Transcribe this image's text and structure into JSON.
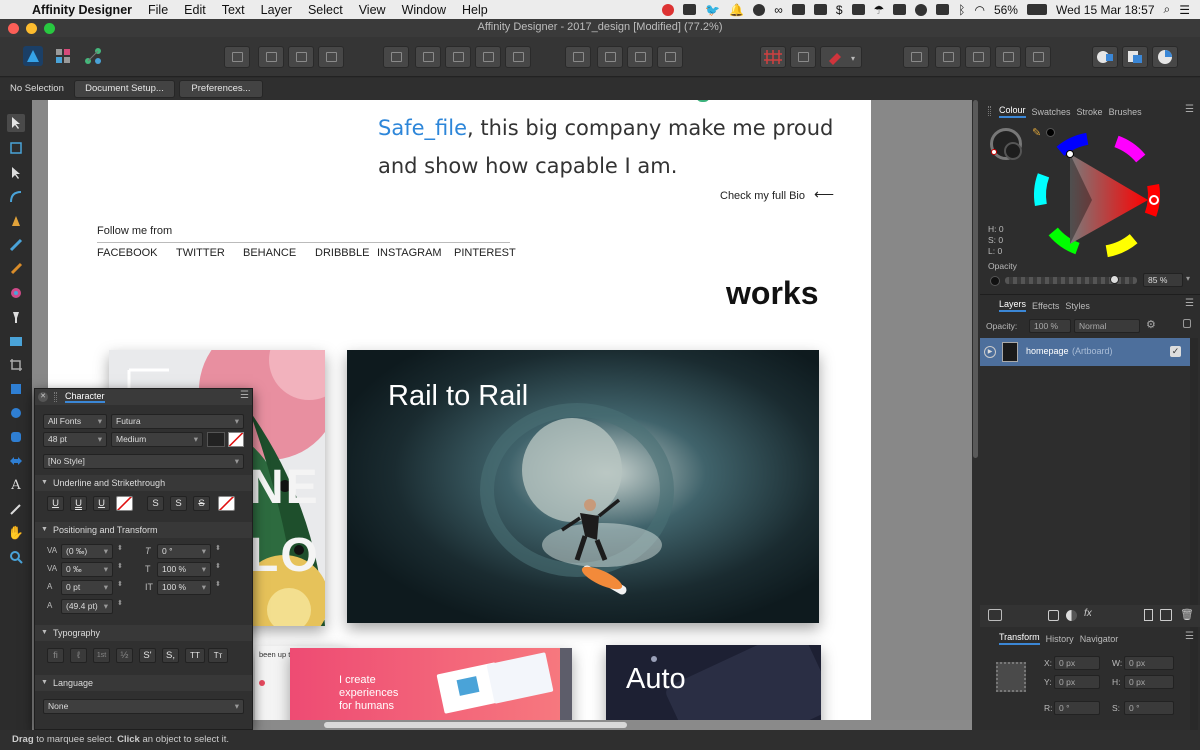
{
  "menubar": {
    "app_name": "Affinity Designer",
    "items": [
      "File",
      "Edit",
      "Text",
      "Layer",
      "Select",
      "View",
      "Window",
      "Help"
    ],
    "battery": "56%",
    "datetime": "Wed 15 Mar  18:57"
  },
  "window": {
    "title": "Affinity Designer - 2017_design [Modified] (77.2%)"
  },
  "context_bar": {
    "selection": "No Selection",
    "document_setup": "Document Setup...",
    "preferences": "Preferences..."
  },
  "artboard": {
    "intro_link": "Safe_file",
    "intro_rest": ", this big company make me proud",
    "intro_line2": "and show how capable I am.",
    "bio_link": "Check my full Bio",
    "bio_arrow": "⟵",
    "follow_label": "Follow me from",
    "social": [
      "FACEBOOK",
      "TWITTER",
      "BEHANCE",
      "DRIBBBLE",
      "INSTAGRAM",
      "PINTEREST"
    ],
    "works_title": "works",
    "card_letters_top": "NE",
    "card_letters_bottom": "LO",
    "hero_title": "Rail to Rail",
    "small_text": "been up to",
    "create_text_1": "I create",
    "create_text_2": "experiences",
    "create_text_3": "for humans",
    "auto_title": "Auto"
  },
  "colour_panel": {
    "tabs": [
      "Colour",
      "Swatches",
      "Stroke",
      "Brushes"
    ],
    "h_label": "H: 0",
    "s_label": "S: 0",
    "l_label": "L: 0",
    "opacity_label": "Opacity",
    "opacity_value": "85 %",
    "opacity_fraction": 0.85
  },
  "layers_panel": {
    "tabs": [
      "Layers",
      "Effects",
      "Styles"
    ],
    "opacity_label": "Opacity:",
    "opacity_value": "100 %",
    "blend_mode": "Normal",
    "layer_name": "homepage",
    "layer_type": "(Artboard)"
  },
  "transform_panel": {
    "tabs": [
      "Transform",
      "History",
      "Navigator"
    ],
    "x_label": "X:",
    "x_value": "0 px",
    "y_label": "Y:",
    "y_value": "0 px",
    "w_label": "W:",
    "w_value": "0 px",
    "h_label": "H:",
    "h_value": "0 px",
    "r_label": "R:",
    "r_value": "0 °",
    "s_label": "S:",
    "s_value": "0 °"
  },
  "character_panel": {
    "title": "Character",
    "font_collection": "All Fonts",
    "font_family": "Futura",
    "font_size": "48 pt",
    "font_weight": "Medium",
    "style": "[No Style]",
    "sec_underline": "Underline and Strikethrough",
    "underline_btns": [
      "U",
      "U",
      "U"
    ],
    "strike_btns": [
      "S",
      "S",
      "S"
    ],
    "sec_position": "Positioning and Transform",
    "kerning": "(0 ‰)",
    "tracking": "0 ‰",
    "baseline": "0 pt",
    "leading": "(49.4 pt)",
    "shear": "0 °",
    "vscale": "100 %",
    "hscale": "100 %",
    "sec_typography": "Typography",
    "typo_btns": [
      "fi",
      "ℓ",
      "1st",
      "½",
      "S'",
      "S,",
      "TT",
      "Tт"
    ],
    "sec_language": "Language",
    "language": "None"
  },
  "status": {
    "drag": "Drag",
    "text1": " to marquee select. ",
    "click": "Click",
    "text2": " an object to select it."
  },
  "colors": {
    "accent": "#3b87d6",
    "link_blue": "#2d86d9",
    "selection": "#4d6f9c"
  }
}
